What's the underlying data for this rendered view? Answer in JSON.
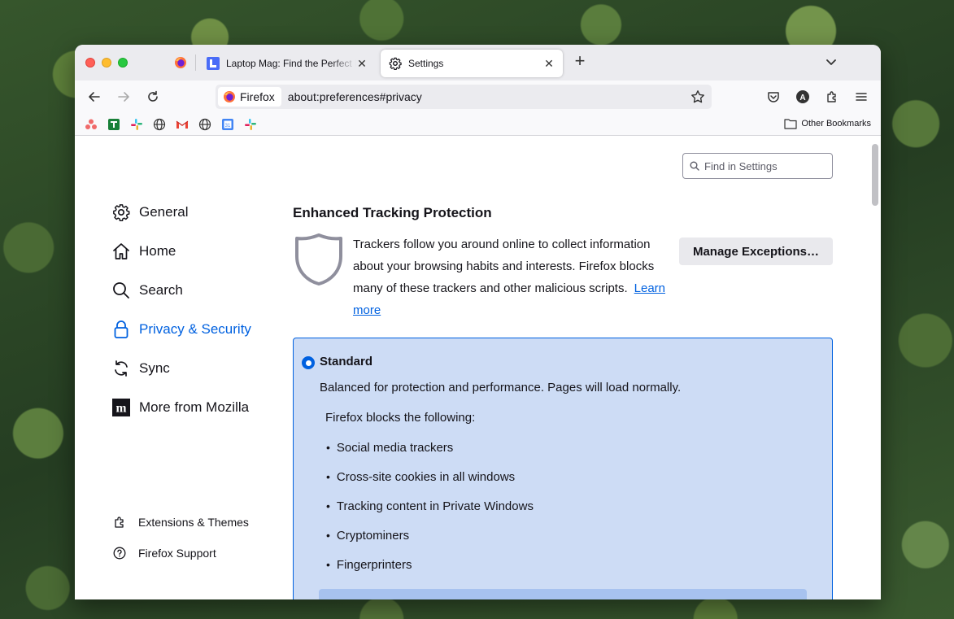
{
  "tabs": [
    {
      "title": "Laptop Mag: Find the Perfect Laptop",
      "close": "✕"
    },
    {
      "title": "Settings",
      "close": "✕"
    }
  ],
  "newtab": "+",
  "urlbar": {
    "identity": "Firefox",
    "url": "about:preferences#privacy"
  },
  "bookmarks": {
    "other": "Other Bookmarks"
  },
  "search": {
    "placeholder": "Find in Settings"
  },
  "categories": [
    {
      "label": "General",
      "icon": "gear-icon"
    },
    {
      "label": "Home",
      "icon": "home-icon"
    },
    {
      "label": "Search",
      "icon": "search-icon"
    },
    {
      "label": "Privacy & Security",
      "icon": "lock-icon",
      "selected": true
    },
    {
      "label": "Sync",
      "icon": "sync-icon"
    },
    {
      "label": "More from Mozilla",
      "icon": "mozilla-icon"
    }
  ],
  "sidebar_footer": [
    {
      "label": "Extensions & Themes",
      "icon": "puzzle-icon"
    },
    {
      "label": "Firefox Support",
      "icon": "help-icon"
    }
  ],
  "etp": {
    "heading": "Enhanced Tracking Protection",
    "description": "Trackers follow you around online to collect information about your browsing habits and interests. Firefox blocks many of these trackers and other malicious scripts.",
    "learn_more": "Learn more",
    "manage_button": "Manage Exceptions…"
  },
  "standard": {
    "title": "Standard",
    "description": "Balanced for protection and performance. Pages will load normally.",
    "blocks_heading": "Firefox blocks the following:",
    "items": [
      "Social media trackers",
      "Cross-site cookies in all windows",
      "Tracking content in Private Windows",
      "Cryptominers",
      "Fingerprinters"
    ]
  },
  "colors": {
    "accent": "#0061e0",
    "selected_box": "#cddcf5"
  }
}
